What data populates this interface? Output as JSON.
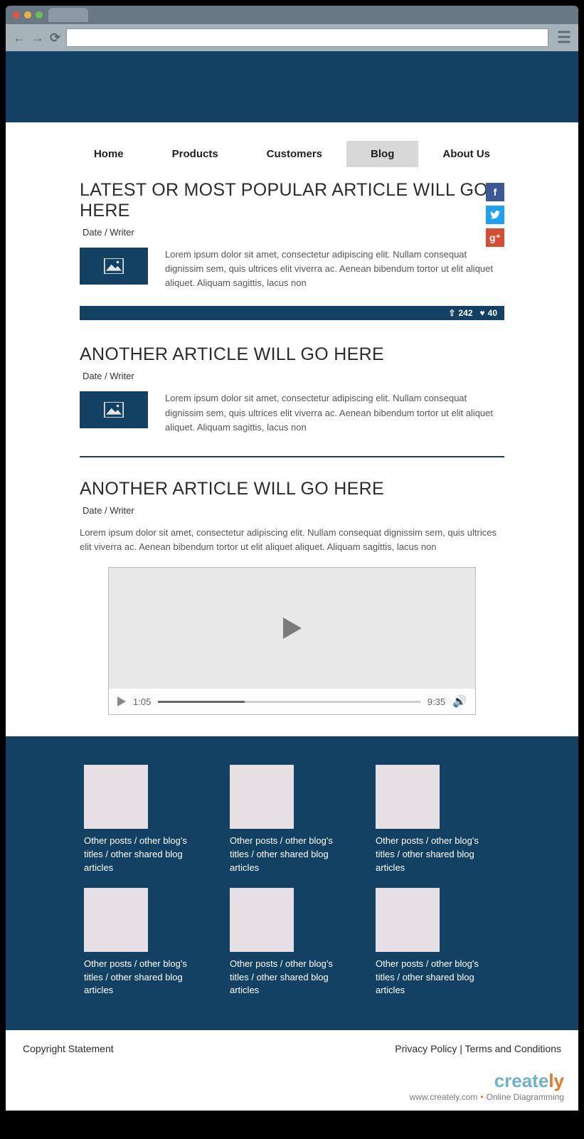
{
  "nav": {
    "items": [
      "Home",
      "Products",
      "Customers",
      "Blog",
      "About Us"
    ],
    "active": "Blog"
  },
  "article1": {
    "title": "LATEST OR MOST POPULAR ARTICLE WILL GO HERE",
    "meta": "Date / Writer",
    "excerpt": "Lorem ipsum dolor sit amet, consectetur adipiscing elit. Nullam consequat dignissim sem, quis ultrices elit viverra ac. Aenean bibendum tortor ut elit aliquet aliquet. Aliquam sagittis, lacus non",
    "uploads": "242",
    "likes": "40"
  },
  "article2": {
    "title": "ANOTHER ARTICLE WILL GO HERE",
    "meta": "Date / Writer",
    "excerpt": "Lorem ipsum dolor sit amet, consectetur adipiscing elit. Nullam consequat dignissim sem, quis ultrices elit viverra ac. Aenean bibendum tortor ut elit aliquet aliquet. Aliquam sagittis, lacus non"
  },
  "article3": {
    "title": "ANOTHER ARTICLE WILL GO HERE",
    "meta": "Date / Writer",
    "excerpt": "Lorem ipsum dolor sit amet, consectetur adipiscing elit. Nullam consequat dignissim sem, quis ultrices elit viverra ac. Aenean bibendum tortor ut elit aliquet aliquet. Aliquam sagittis, lacus non"
  },
  "video": {
    "current": "1:05",
    "total": "9:35"
  },
  "related_text": "Other posts / other blog's titles / other shared blog articles",
  "footer": {
    "copyright": "Copyright Statement",
    "privacy": "Privacy Policy",
    "terms": "Terms and Conditions"
  },
  "branding": {
    "site": "www.creately.com",
    "tagline": "Online Diagramming"
  }
}
